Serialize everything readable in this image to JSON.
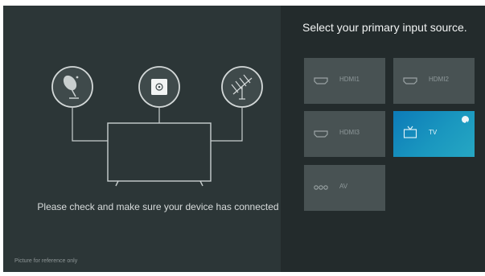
{
  "title": "Select your primary input source.",
  "message": "Please check and make sure your device has connected",
  "footnote": "Picture for reference only",
  "sources": [
    {
      "label": "HDMI1",
      "icon": "hdmi-port-icon"
    },
    {
      "label": "HDMI2",
      "icon": "hdmi-port-icon"
    },
    {
      "label": "HDMI3",
      "icon": "hdmi-port-icon"
    },
    {
      "label": "TV",
      "icon": "tv-icon",
      "selected": true
    },
    {
      "label": "AV",
      "icon": "av-jacks-icon"
    }
  ],
  "illustration": {
    "devices": [
      "satellite-dish-icon",
      "set-top-box-icon",
      "antenna-icon"
    ],
    "display": "tv-screen-icon"
  },
  "colors": {
    "accent": "#1a97bf",
    "background": "#232b2c",
    "panel": "#2c3637",
    "tile": "#485253"
  }
}
